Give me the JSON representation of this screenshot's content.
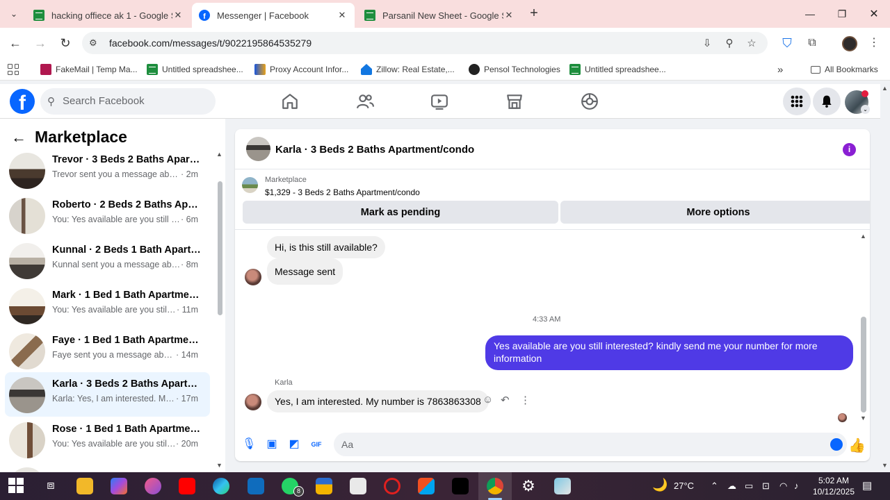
{
  "browser": {
    "tabs": [
      {
        "title": "hacking offiece ak 1 - Google Sh",
        "icon": "google-sheets-icon"
      },
      {
        "title": "Messenger | Facebook",
        "icon": "facebook-icon",
        "active": true
      },
      {
        "title": "Parsanil New Sheet - Google Sh",
        "icon": "google-sheets-icon"
      }
    ],
    "url": "facebook.com/messages/t/9022195864535279",
    "bookmarks": [
      {
        "label": "FakeMail | Temp Ma...",
        "icon": "fakemail-icon"
      },
      {
        "label": "Untitled spreadshee...",
        "icon": "google-sheets-icon"
      },
      {
        "label": "Proxy Account Infor...",
        "icon": "proxy-icon"
      },
      {
        "label": "Zillow: Real Estate,...",
        "icon": "zillow-icon"
      },
      {
        "label": "Pensol Technologies",
        "icon": "pensol-icon"
      },
      {
        "label": "Untitled spreadshee...",
        "icon": "google-sheets-icon"
      }
    ],
    "all_bookmarks": "All Bookmarks",
    "more_bookmarks": "»"
  },
  "facebook": {
    "logo": "f",
    "search_placeholder": "Search Facebook"
  },
  "sidebar": {
    "title": "Marketplace",
    "conversations": [
      {
        "name": "Trevor · 3 Beds 2 Baths Apartme...",
        "preview": "Trevor sent you a message about y...",
        "time": " · 2m"
      },
      {
        "name": "Roberto · 2 Beds 2 Baths Apart...",
        "preview": "You: Yes available are you still inter...",
        "time": " · 6m"
      },
      {
        "name": "Kunnal · 2 Beds 1 Bath Apartme...",
        "preview": "Kunnal sent you a message about ...",
        "time": " · 8m"
      },
      {
        "name": "Mark · 1 Bed 1 Bath Apartment/...",
        "preview": "You: Yes available are you still int...",
        "time": " · 11m"
      },
      {
        "name": "Faye · 1 Bed 1 Bath Apartment/c...",
        "preview": "Faye sent you a message about y...",
        "time": " · 14m"
      },
      {
        "name": "Karla · 3 Beds 2 Baths Apartmen...",
        "preview": "Karla: Yes, I am interested. My nu...",
        "time": " · 17m",
        "active": true
      },
      {
        "name": "Rose · 1 Bed 1 Bath Apartment/c...",
        "preview": "You: Yes available are you still int...",
        "time": " · 20m"
      }
    ]
  },
  "chat": {
    "title": "Karla · 3 Beds 2 Baths Apartment/condo",
    "info_icon": "i",
    "marketplace_label": "Marketplace",
    "listing": "$1,329 - 3 Beds 2 Baths Apartment/condo",
    "mark_pending": "Mark as pending",
    "more_options": "More options",
    "messages": [
      {
        "from": "them",
        "text": "Hi, is this still available?"
      },
      {
        "from": "them",
        "text": "Message sent"
      },
      {
        "type": "timestamp",
        "text": "4:33 AM"
      },
      {
        "from": "me",
        "text": "Yes available are you still interested? kindly send me your number for more information"
      },
      {
        "from": "them",
        "sender": "Karla",
        "text": "Yes, I am interested. My number is 7863863308"
      }
    ],
    "composer_placeholder": "Aa"
  },
  "taskbar": {
    "weather": "27°C",
    "time": "5:02 AM",
    "date": "10/12/2025",
    "whatsapp_badge": "8"
  }
}
